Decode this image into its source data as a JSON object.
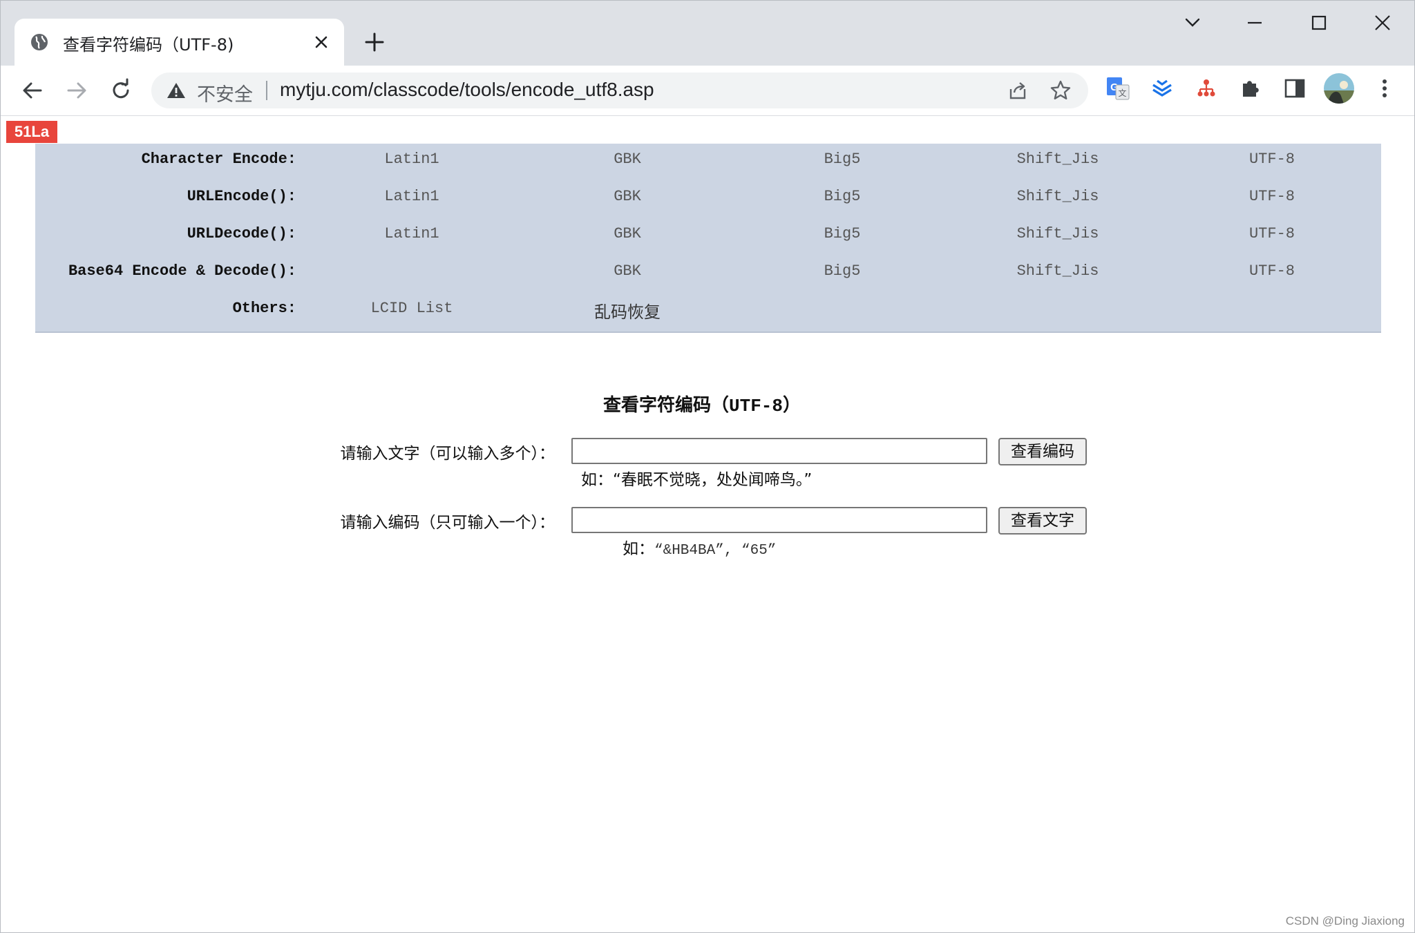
{
  "tab": {
    "title": "查看字符编码（UTF-8)"
  },
  "address_bar": {
    "security_label": "不安全",
    "url": "mytju.com/classcode/tools/encode_utf8.asp"
  },
  "page": {
    "badge": "51La",
    "encode_table": {
      "rows": [
        {
          "label": "Character Encode:",
          "cells": [
            "Latin1",
            "GBK",
            "Big5",
            "Shift_Jis",
            "UTF-8"
          ]
        },
        {
          "label": "URLEncode():",
          "cells": [
            "Latin1",
            "GBK",
            "Big5",
            "Shift_Jis",
            "UTF-8"
          ]
        },
        {
          "label": "URLDecode():",
          "cells": [
            "Latin1",
            "GBK",
            "Big5",
            "Shift_Jis",
            "UTF-8"
          ]
        },
        {
          "label": "Base64 Encode & Decode():",
          "cells": [
            "",
            "GBK",
            "Big5",
            "Shift_Jis",
            "UTF-8"
          ]
        },
        {
          "label": "Others:",
          "cells": [
            "LCID List",
            "乱码恢复",
            "",
            "",
            ""
          ]
        }
      ]
    },
    "form": {
      "title_prefix": "查看字符编码（",
      "title_code": "UTF-8",
      "title_suffix": "）",
      "text_input": {
        "label": "请输入文字（可以输入多个）：",
        "value": "",
        "button": "查看编码",
        "hint": "如：“春眠不觉晓，处处闻啼鸟。”"
      },
      "code_input": {
        "label": "请输入编码（只可输入一个）：",
        "value": "",
        "button": "查看文字",
        "hint_prefix": "如：",
        "hint_code": "“&HB4BA”, “65”"
      }
    }
  },
  "watermark": "CSDN @Ding Jiaxiong",
  "icons": [
    "globe-icon",
    "close-icon",
    "plus-icon",
    "chevron-down-icon",
    "minimize-icon",
    "maximize-icon",
    "window-close-icon",
    "back-icon",
    "forward-icon",
    "reload-icon",
    "warning-icon",
    "share-icon",
    "star-icon",
    "translate-icon",
    "extension-icon",
    "puzzle-icon",
    "sidepanel-icon",
    "profile-avatar",
    "menu-icon"
  ]
}
